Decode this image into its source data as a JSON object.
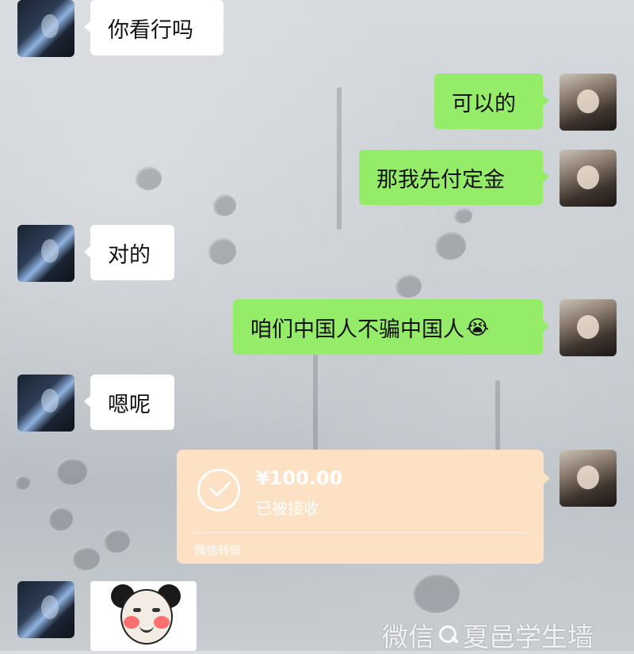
{
  "messages": [
    {
      "side": "received",
      "text": "你看行吗"
    },
    {
      "side": "sent",
      "text": "可以的"
    },
    {
      "side": "sent",
      "text": "那我先付定金"
    },
    {
      "side": "received",
      "text": "对的"
    },
    {
      "side": "sent",
      "text": "咱们中国人不骗中国人",
      "emoji": "😭"
    },
    {
      "side": "received",
      "text": "嗯呢"
    }
  ],
  "transfer": {
    "amount": "¥100.00",
    "status": "已被接收",
    "footer": "微信转账"
  },
  "sticker": {
    "description_icon": "panda-face-sticker-icon"
  },
  "watermark": {
    "prefix": "微信",
    "icon": "search-icon",
    "name": "夏邑学生墙"
  },
  "colors": {
    "sent_bubble": "#95ec69",
    "received_bubble": "#ffffff",
    "transfer_card": "#fde1c4"
  }
}
